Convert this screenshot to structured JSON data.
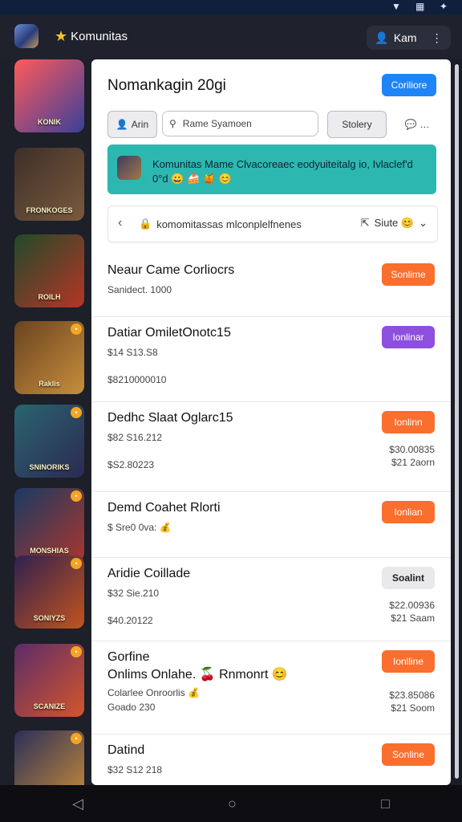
{
  "header": {
    "app_title": "Komunitas",
    "user_label": "Kam"
  },
  "sidebar": {
    "tiles": [
      {
        "label": "KONIK",
        "colors": [
          "#ff5a5a",
          "#3a3f9a"
        ]
      },
      {
        "label": "FRONKOGES",
        "colors": [
          "#3d2f2a",
          "#7a5a3c"
        ]
      },
      {
        "label": "ROILH",
        "colors": [
          "#204a2a",
          "#b73526"
        ]
      },
      {
        "label": "Raklis",
        "colors": [
          "#6a4320",
          "#c78e3c"
        ]
      },
      {
        "label": "SNINORIKS",
        "colors": [
          "#2a6470",
          "#2c2a52"
        ]
      },
      {
        "label": "MONSHIAS",
        "colors": [
          "#193a62",
          "#a8362f"
        ]
      },
      {
        "label": "SONIYZS",
        "colors": [
          "#2f2150",
          "#c4531d"
        ]
      },
      {
        "label": "SCANIZE",
        "colors": [
          "#5b2c67",
          "#d4552c"
        ]
      },
      {
        "label": "",
        "colors": [
          "#2a2f58",
          "#c88a3a"
        ]
      }
    ]
  },
  "panel": {
    "title": "Nomankagin 20gi",
    "top_action": "Coriliore",
    "filters": {
      "chip_left": "Arin",
      "search_text": "Rame Syamoen",
      "chip_right": "Stolery"
    },
    "notice": "Komunitas Mame Clvacoreaec eodyuiteitalg io, Ivlaclef'd 0°d 😀 🍰 🍯 😊",
    "breadcrumb": {
      "path": "komomitassas mlconplelfnenes",
      "right_label": "Siute 😊"
    },
    "items": [
      {
        "title": "Neaur Came Corliocrs",
        "sub": "Sanidect. 1000",
        "meta": "",
        "right": "",
        "button": "Sonlime",
        "button_color": "orange"
      },
      {
        "title": "Datiar OmiletOnotc15",
        "sub": "$14 S13.S8",
        "meta": "$8210000010",
        "right": "",
        "button": "Ionlinar",
        "button_color": "purple"
      },
      {
        "title": "Dedhc Slaat Oglarc15",
        "sub": "$82 S16.212",
        "meta": "$S2.80223",
        "right": "$30.00835\n$21 2aorn",
        "button": "Ionlinn",
        "button_color": "orange"
      },
      {
        "title": "Demd Coahet Rlorti",
        "sub": "$ Sre0 0va: 💰",
        "meta": "",
        "right": "",
        "button": "Ionlian",
        "button_color": "orange"
      },
      {
        "title": "Aridie Coillade",
        "sub": "$32 Sie.210",
        "meta": "$40.20122",
        "right": "$22.00936\n$21 Saam",
        "button": "Soalint",
        "button_color": "grey"
      },
      {
        "title": "Gorfine\nOnlims Onlahe. 🍒 Rnmonrt 😊",
        "sub": "Colarlee Onroorlis 💰",
        "meta": "Goado 230",
        "right": "$23.85086\n$21 Soom",
        "button": "Ionlline",
        "button_color": "orange"
      },
      {
        "title": "Datind",
        "sub": "$32 S12 218",
        "meta": "",
        "right": "",
        "button": "Sonline",
        "button_color": "orange"
      }
    ]
  },
  "nav": {
    "back": "◁",
    "home": "○",
    "recent": "□"
  }
}
